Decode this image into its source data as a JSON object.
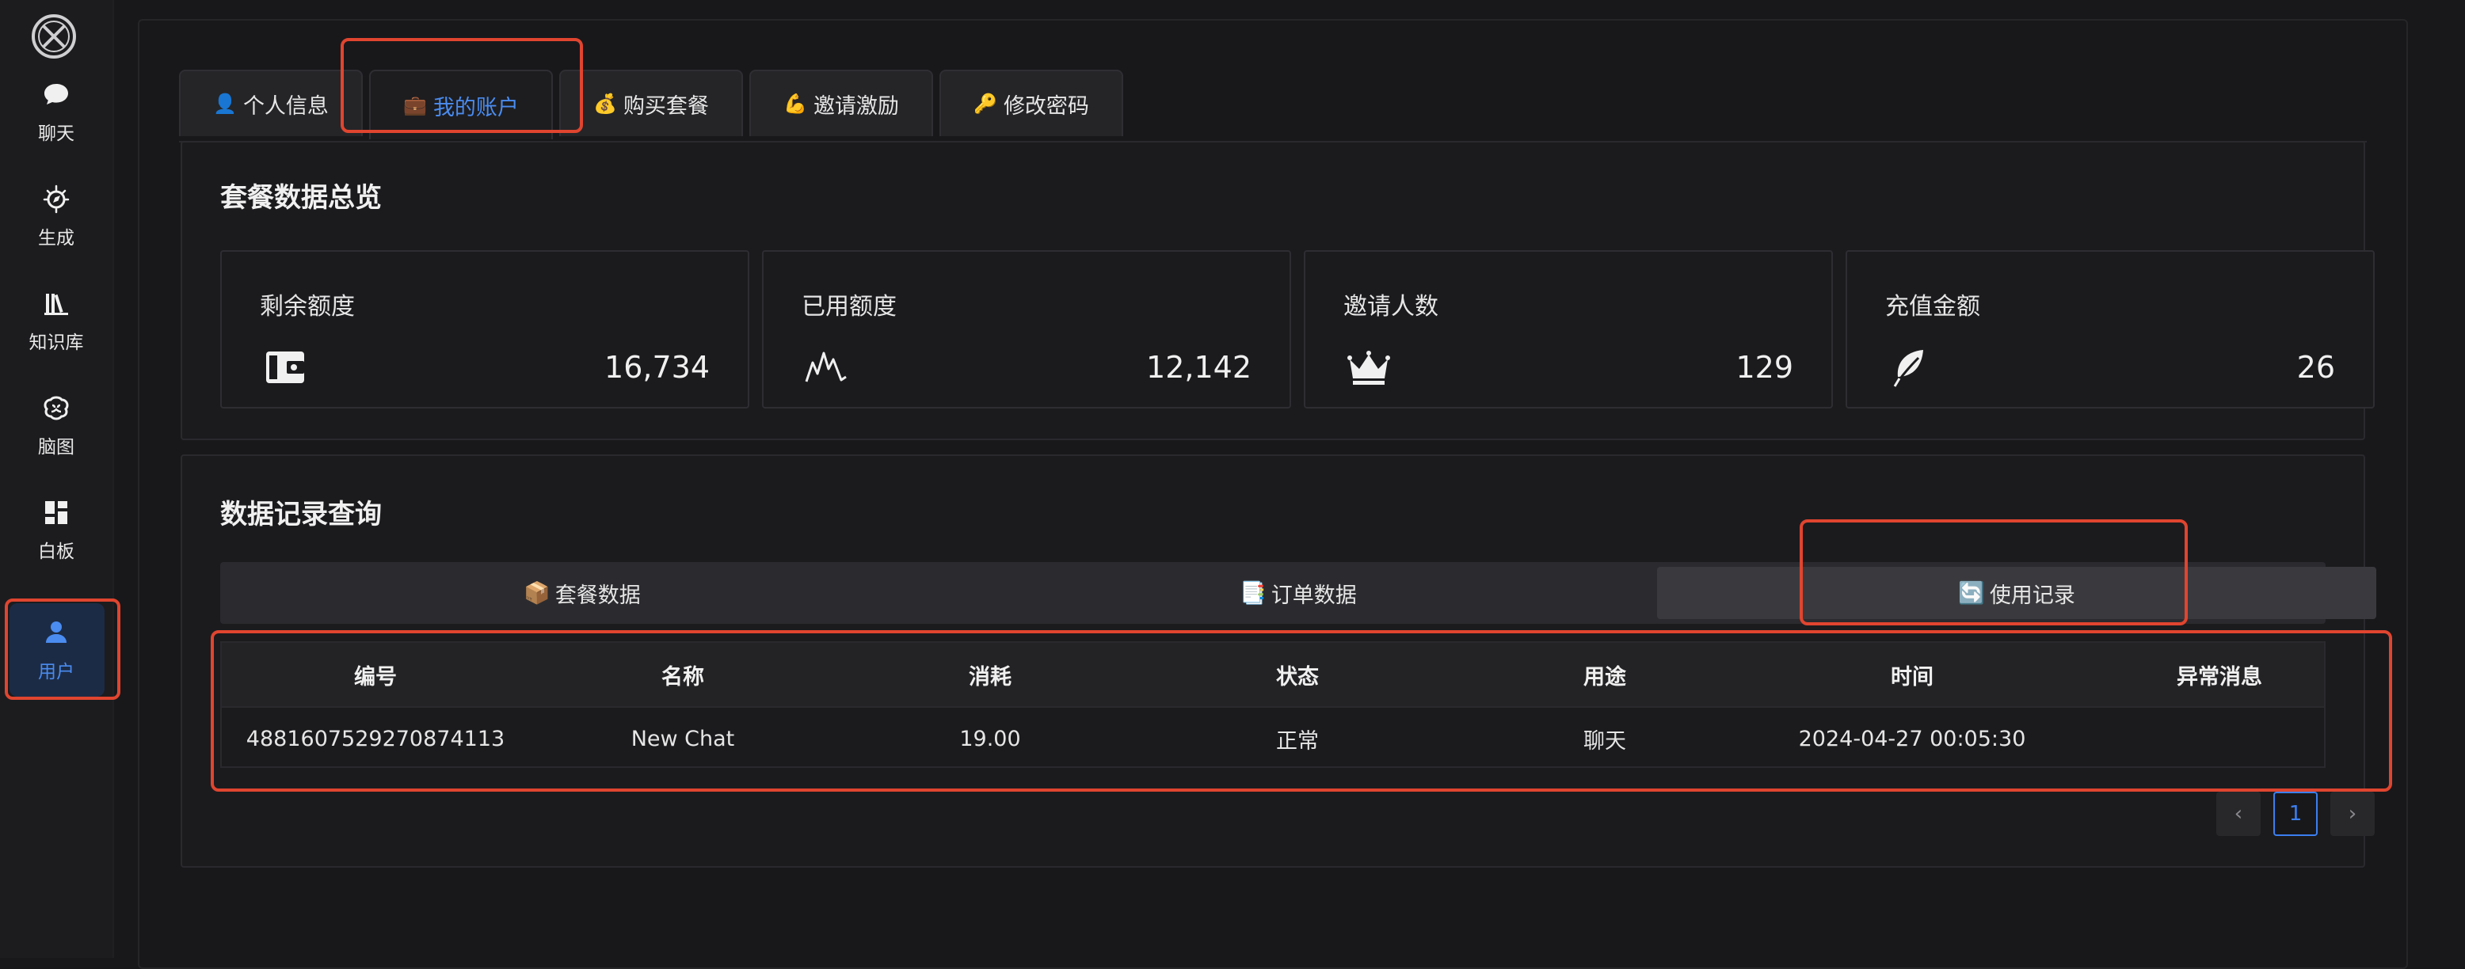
{
  "sidebar": {
    "logo_icon": "x-circle-logo",
    "items": [
      {
        "label": "聊天",
        "icon": "chat-bubble-icon"
      },
      {
        "label": "生成",
        "icon": "compass-sparkle-icon"
      },
      {
        "label": "知识库",
        "icon": "books-icon"
      },
      {
        "label": "脑图",
        "icon": "brain-icon"
      },
      {
        "label": "白板",
        "icon": "dashboard-icon"
      },
      {
        "label": "用户",
        "icon": "user-icon",
        "active": true
      }
    ]
  },
  "tabs": [
    {
      "icon": "👤",
      "label": "个人信息"
    },
    {
      "icon": "💼",
      "label": "我的账户",
      "active": true
    },
    {
      "icon": "💰",
      "label": "购买套餐"
    },
    {
      "icon": "💪",
      "label": "邀请激励"
    },
    {
      "icon": "🔑",
      "label": "修改密码"
    }
  ],
  "overview": {
    "title": "套餐数据总览",
    "stats": [
      {
        "label": "剩余额度",
        "value": "16,734",
        "icon": "wallet-icon"
      },
      {
        "label": "已用额度",
        "value": "12,142",
        "icon": "chart-peaks-icon"
      },
      {
        "label": "邀请人数",
        "value": "129",
        "icon": "crown-icon"
      },
      {
        "label": "充值金额",
        "value": "26",
        "icon": "leaf-icon"
      }
    ]
  },
  "records": {
    "title": "数据记录查询",
    "segments": [
      {
        "icon": "📦",
        "label": "套餐数据"
      },
      {
        "icon": "📑",
        "label": "订单数据"
      },
      {
        "icon": "🔄",
        "label": "使用记录",
        "active": true
      }
    ],
    "columns": [
      "编号",
      "名称",
      "消耗",
      "状态",
      "用途",
      "时间",
      "异常消息"
    ],
    "rows": [
      [
        "4881607529270874113",
        "New Chat",
        "19.00",
        "正常",
        "聊天",
        "2024-04-27 00:05:30",
        ""
      ]
    ],
    "pagination": {
      "prev": "‹",
      "current": "1",
      "next": "›"
    }
  },
  "colors": {
    "accent": "#4a8cf0",
    "highlight": "#e0452f",
    "background": "#18181b"
  }
}
